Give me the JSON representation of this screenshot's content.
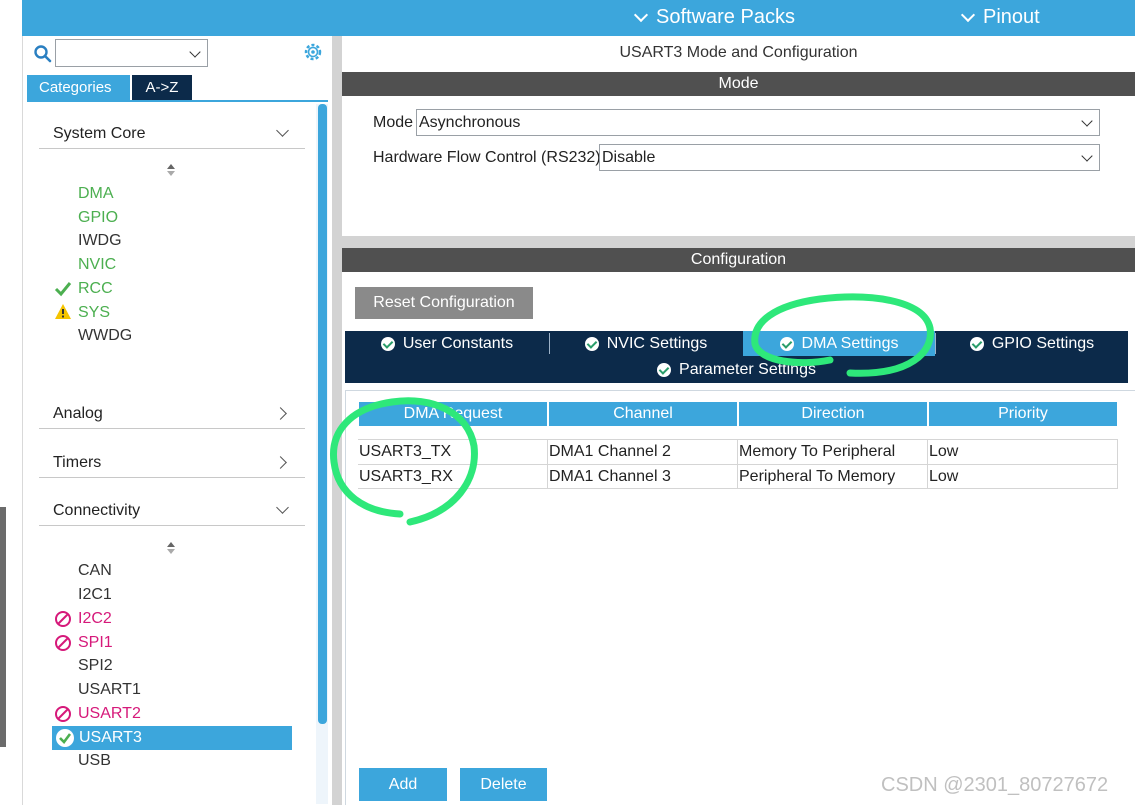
{
  "header": {
    "software_packs_label": "Software Packs",
    "pinout_label": "Pinout"
  },
  "sidebar": {
    "search_value": "",
    "tabs": [
      {
        "label": "Categories"
      },
      {
        "label": "A->Z"
      }
    ],
    "categories": [
      {
        "label": "System Core",
        "expanded": true
      },
      {
        "label": "Analog",
        "expanded": false
      },
      {
        "label": "Timers",
        "expanded": false
      },
      {
        "label": "Connectivity",
        "expanded": true
      }
    ],
    "system_core_items": [
      {
        "label": "DMA",
        "status": "configured"
      },
      {
        "label": "GPIO",
        "status": "configured"
      },
      {
        "label": "IWDG",
        "status": "none"
      },
      {
        "label": "NVIC",
        "status": "configured"
      },
      {
        "label": "RCC",
        "status": "ok"
      },
      {
        "label": "SYS",
        "status": "warning"
      },
      {
        "label": "WWDG",
        "status": "none"
      }
    ],
    "connectivity_items": [
      {
        "label": "CAN",
        "status": "none"
      },
      {
        "label": "I2C1",
        "status": "none"
      },
      {
        "label": "I2C2",
        "status": "disabled"
      },
      {
        "label": "SPI1",
        "status": "disabled"
      },
      {
        "label": "SPI2",
        "status": "none"
      },
      {
        "label": "USART1",
        "status": "none"
      },
      {
        "label": "USART2",
        "status": "disabled"
      },
      {
        "label": "USART3",
        "status": "selected"
      },
      {
        "label": "USB",
        "status": "none"
      }
    ]
  },
  "main": {
    "title": "USART3 Mode and Configuration",
    "mode_header": "Mode",
    "mode_label": "Mode",
    "mode_value": "Asynchronous",
    "flow_label": "Hardware Flow Control (RS232)",
    "flow_value": "Disable",
    "config_header": "Configuration",
    "reset_button": "Reset Configuration",
    "config_tabs": [
      {
        "label": "User Constants",
        "active": false
      },
      {
        "label": "NVIC Settings",
        "active": false
      },
      {
        "label": "DMA Settings",
        "active": true
      },
      {
        "label": "GPIO Settings",
        "active": false
      },
      {
        "label": "Parameter Settings",
        "active": false
      }
    ],
    "dma_table": {
      "columns": [
        "DMA Request",
        "Channel",
        "Direction",
        "Priority"
      ],
      "rows": [
        [
          "USART3_TX",
          "DMA1 Channel 2",
          "Memory To Peripheral",
          "Low"
        ],
        [
          "USART3_RX",
          "DMA1 Channel 3",
          "Peripheral To Memory",
          "Low"
        ]
      ]
    },
    "add_button": "Add",
    "delete_button": "Delete"
  },
  "watermark": "CSDN @2301_80727672",
  "colors": {
    "accent": "#3ca6dc",
    "navy": "#0c2a4a",
    "ok_green": "#4caf50",
    "disabled_pink": "#d6197a",
    "warning_yellow": "#f5c400",
    "annotation_green": "#2ee87a"
  }
}
